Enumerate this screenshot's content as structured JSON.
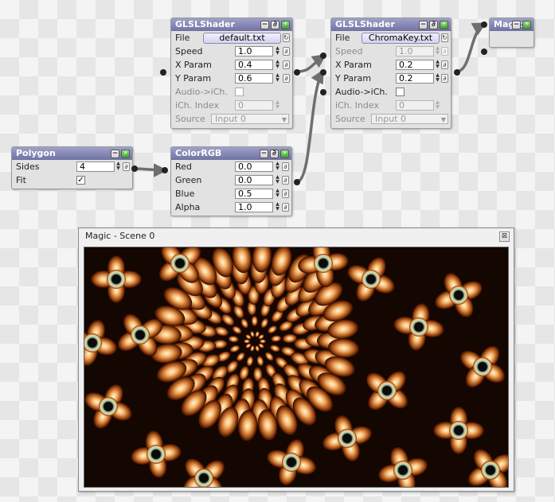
{
  "nodes": {
    "shader1": {
      "title": "GLSLShader",
      "file_label": "File",
      "file_value": "default.txt",
      "speed_label": "Speed",
      "speed_value": "1.0",
      "xparam_label": "X Param",
      "xparam_value": "0.4",
      "yparam_label": "Y Param",
      "yparam_value": "0.6",
      "audio_label": "Audio->iCh.",
      "ich_label": "iCh. Index",
      "ich_value": "0",
      "source_label": "Source",
      "source_value": "Input 0"
    },
    "shader2": {
      "title": "GLSLShader",
      "file_label": "File",
      "file_value": "ChromaKey.txt",
      "speed_label": "Speed",
      "speed_value": "1.0",
      "xparam_label": "X Param",
      "xparam_value": "0.2",
      "yparam_label": "Y Param",
      "yparam_value": "0.2",
      "audio_label": "Audio->iCh.",
      "ich_label": "iCh. Index",
      "ich_value": "0",
      "source_label": "Source",
      "source_value": "Input 0"
    },
    "magic": {
      "title": "Magic"
    },
    "polygon": {
      "title": "Polygon",
      "sides_label": "Sides",
      "sides_value": "4",
      "fit_label": "Fit",
      "fit_checked": "✓"
    },
    "colorrgb": {
      "title": "ColorRGB",
      "red_label": "Red",
      "red_value": "0.0",
      "green_label": "Green",
      "green_value": "0.0",
      "blue_label": "Blue",
      "blue_value": "0.5",
      "alpha_label": "Alpha",
      "alpha_value": "1.0"
    }
  },
  "scene_window": {
    "title": "Magic - Scene 0",
    "close_glyph": "⊠"
  },
  "glyphs": {
    "minimize": "−",
    "link": "∂",
    "reload": "↻",
    "spin_up": "▲",
    "spin_down": "▼",
    "dropdown": "▼",
    "power": "⚡"
  },
  "colors": {
    "node_header": "#7f82b3",
    "wire": "#6f6f6f",
    "port": "#222222",
    "power_button": "#4caf3a"
  }
}
